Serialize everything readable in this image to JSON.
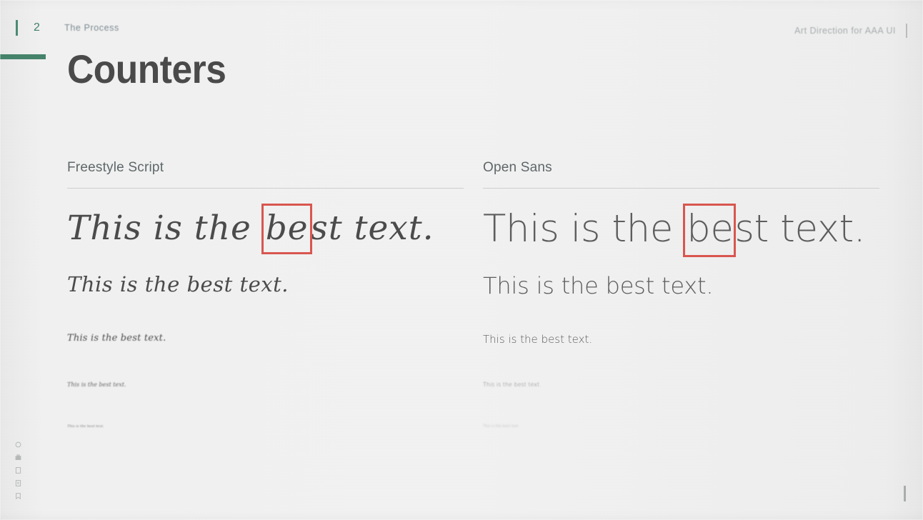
{
  "slide": {
    "eyebrow": {
      "number": "2",
      "section_label": "The Process"
    },
    "top_right_label": "Art Direction for AAA UI",
    "title": "Counters",
    "accent_color": "#45836b",
    "title_color": "#4a4a4a",
    "highlight_color": "#d9564f",
    "background_color": "#efefef"
  },
  "columns": [
    {
      "heading": "Freestyle Script",
      "samples": [
        {
          "before": "This is the ",
          "highlight": "be",
          "after": "st text."
        },
        {
          "before": "This is the best text.",
          "highlight": "",
          "after": ""
        },
        {
          "before": "This is the best text.",
          "highlight": "",
          "after": ""
        },
        {
          "before": "This is the best text.",
          "highlight": "",
          "after": ""
        },
        {
          "before": "This is the best text.",
          "highlight": "",
          "after": ""
        }
      ]
    },
    {
      "heading": "Open Sans",
      "samples": [
        {
          "before": "This is the ",
          "highlight": "be",
          "after": "st text."
        },
        {
          "before": "This is the best text.",
          "highlight": "",
          "after": ""
        },
        {
          "before": "This is the best text.",
          "highlight": "",
          "after": ""
        },
        {
          "before": "This is the best text.",
          "highlight": "",
          "after": ""
        },
        {
          "before": "This is the best text.",
          "highlight": "",
          "after": ""
        }
      ]
    }
  ],
  "icon_rail": [
    {
      "name": "circle-icon"
    },
    {
      "name": "briefcase-icon"
    },
    {
      "name": "document-icon"
    },
    {
      "name": "file-text-icon"
    },
    {
      "name": "bookmark-icon"
    }
  ]
}
